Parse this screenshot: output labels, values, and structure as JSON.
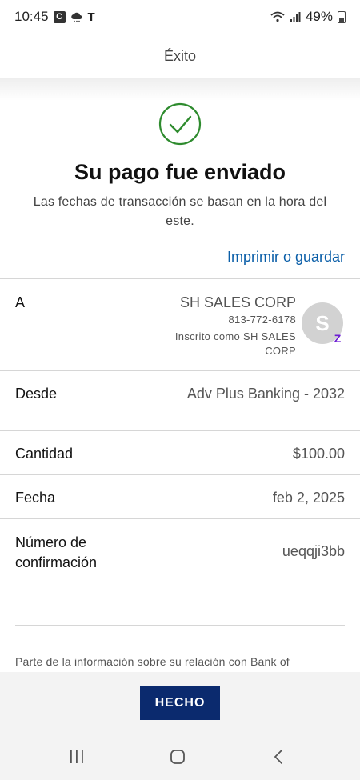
{
  "status_bar": {
    "time": "10:45",
    "carrier_box_letter": "C",
    "carrier_glyph": "T",
    "battery": "49%",
    "icons": [
      "weather-icon",
      "wifi-icon",
      "signal-icon",
      "battery-icon"
    ]
  },
  "header": {
    "title": "Éxito"
  },
  "success": {
    "title": "Su pago fue enviado",
    "subtitle": "Las fechas de transacción se basan en la hora del este.",
    "print_link": "Imprimir o guardar",
    "accent_color": "#2e8b2e"
  },
  "details": {
    "to": {
      "label": "A",
      "name": "SH SALES CORP",
      "phone": "813-772-6178",
      "enrolled": "Inscrito como SH SALES CORP",
      "avatar_letter": "S",
      "badge_letter": "Z"
    },
    "from": {
      "label": "Desde",
      "value": "Adv Plus Banking - 2032"
    },
    "amount": {
      "label": "Cantidad",
      "value": "$100.00"
    },
    "date": {
      "label": "Fecha",
      "value": "feb 2, 2025"
    },
    "confirmation": {
      "label": "Número de confirmación",
      "value": "ueqqji3bb"
    }
  },
  "footer_note": "Parte de la información sobre su relación con Bank of",
  "done_button": "HECHO",
  "brand_color": "#0b2a6e",
  "link_color": "#0a5ea8"
}
